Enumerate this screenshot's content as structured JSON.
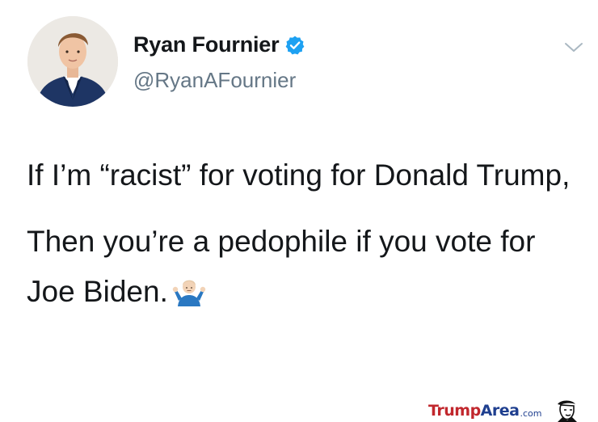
{
  "tweet": {
    "author": {
      "display_name": "Ryan Fournier",
      "handle": "@RyanAFournier",
      "verified": true,
      "avatar_icon": "avatar-man-in-suit"
    },
    "menu_icon": "chevron-down-icon",
    "text": {
      "paragraph_1": "If I’m “racist” for voting for Donald Trump,",
      "paragraph_2": "Then you’re a pedophile if you vote for Joe Biden.",
      "emoji": "person-shrugging"
    }
  },
  "watermark": {
    "brand_part_1": "Trump",
    "brand_part_2": "Area",
    "domain": ".com",
    "logo_icon": "trump-caricature-icon"
  },
  "colors": {
    "verified_blue": "#1da1f2",
    "handle_gray": "#657786",
    "text": "#14171a",
    "watermark_red": "#c1272d",
    "watermark_blue": "#1f3f8f"
  }
}
